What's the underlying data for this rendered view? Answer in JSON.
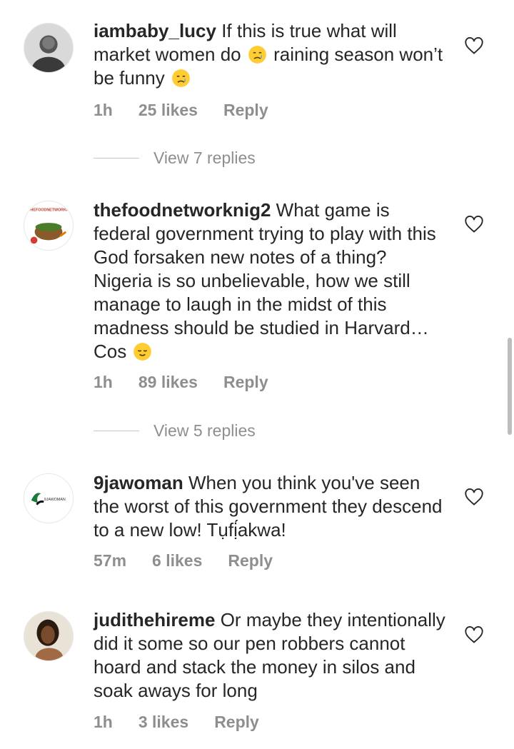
{
  "comments": [
    {
      "username": "iambaby_lucy",
      "text_parts": [
        " If this is true what will market women do ",
        " raining season won’t be funny "
      ],
      "time": "1h",
      "likes": "25 likes",
      "reply_label": "Reply",
      "view_replies": "View 7 replies",
      "emoji": "crying-face-icon"
    },
    {
      "username": "thefoodnetworknig2",
      "text_parts": [
        " What game is federal government trying to play with this God forsaken new notes of a thing? Nigeria is so unbelievable, how we still manage to laugh in the midst of this madness should be studied in Harvard… Cos "
      ],
      "time": "1h",
      "likes": "89 likes",
      "reply_label": "Reply",
      "view_replies": "View 5 replies",
      "emoji": "relieved-face-icon",
      "avatar_text": "THEFOODNETWORKN"
    },
    {
      "username": "9jawoman",
      "text_parts": [
        " When you think you've seen the worst of this government they descend to a new low! Tụfị́akwa!"
      ],
      "time": "57m",
      "likes": "6 likes",
      "reply_label": "Reply",
      "avatar_text": "9JAWOMAN"
    },
    {
      "username": "judithehireme",
      "text_parts": [
        " Or maybe they intentionally did it some so our pen robbers cannot hoard and stack the money in silos and soak aways for long"
      ],
      "time": "1h",
      "likes": "3 likes",
      "reply_label": "Reply"
    }
  ],
  "colors": {
    "text": "#262626",
    "meta": "#8e8e8e",
    "divider": "#c7c7c7"
  }
}
